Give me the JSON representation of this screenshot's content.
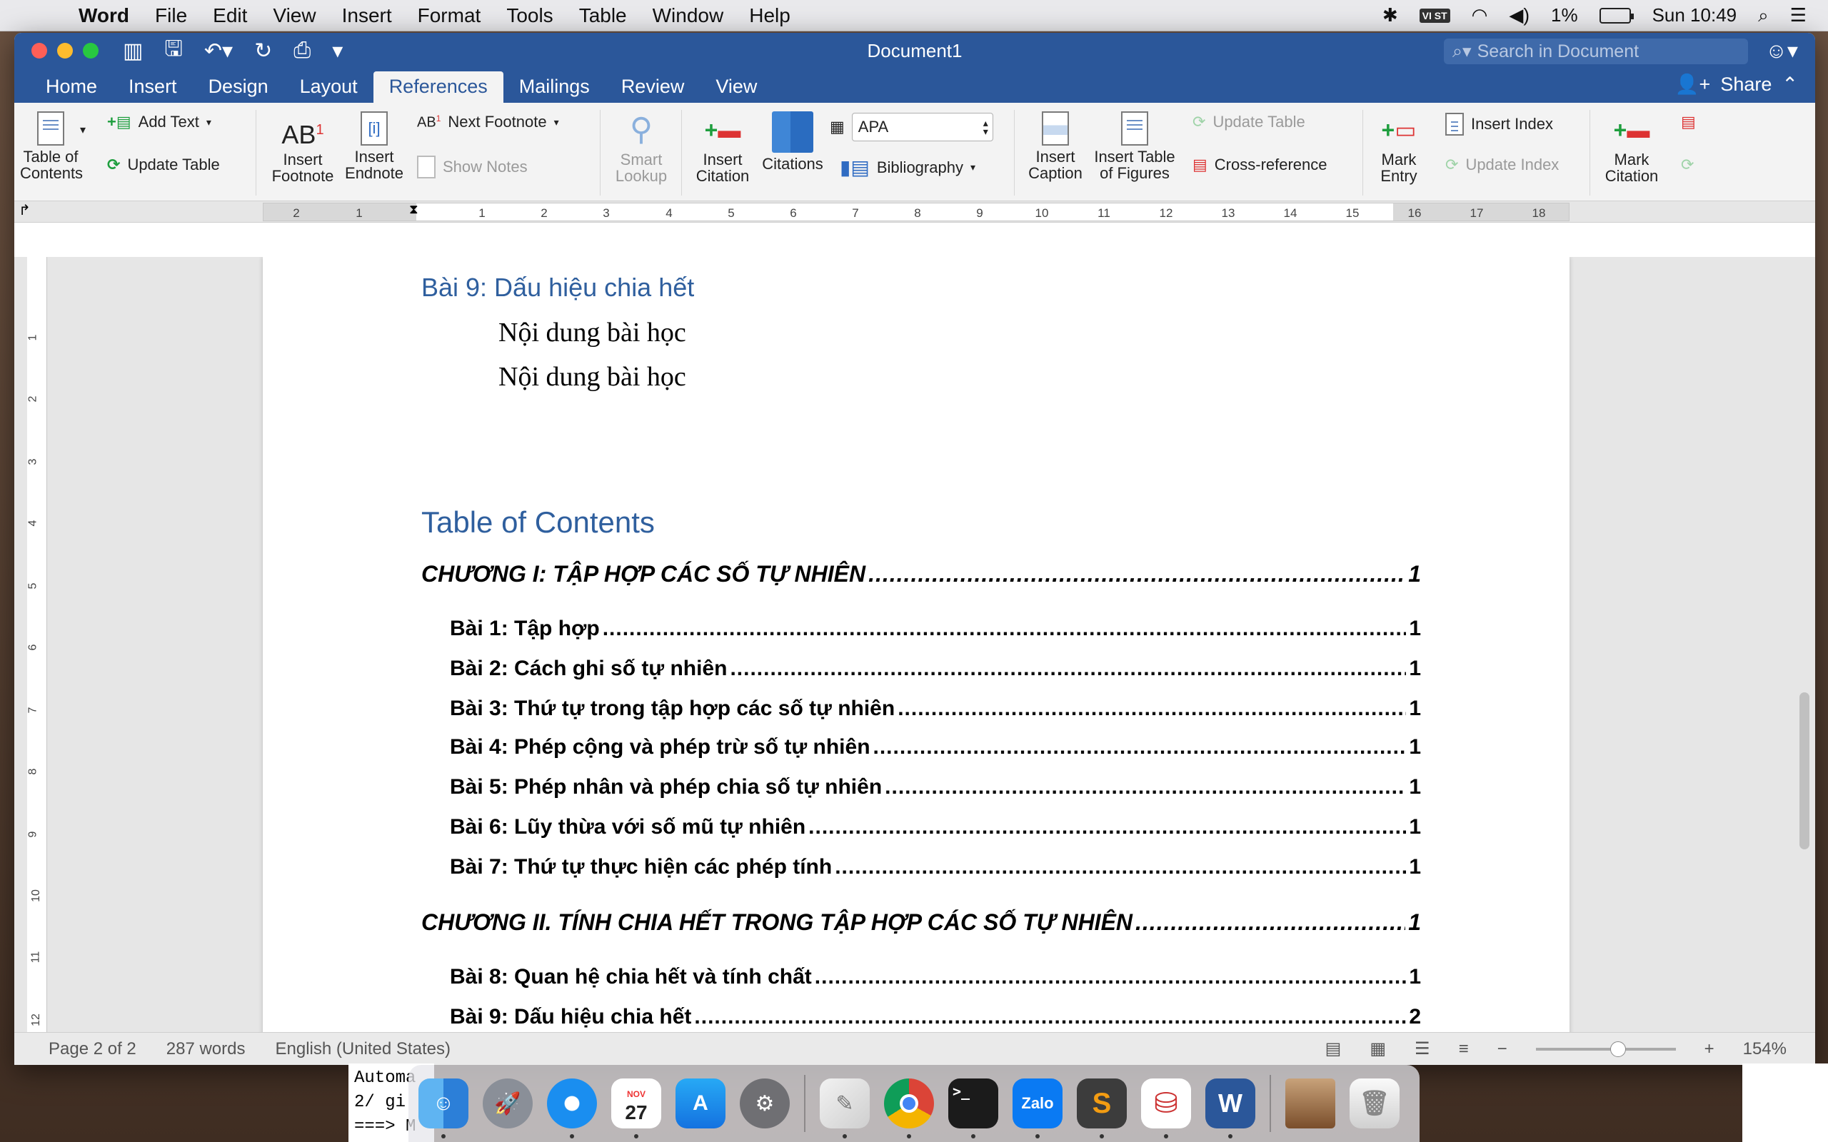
{
  "menubar": {
    "app_name": "Word",
    "items": [
      "File",
      "Edit",
      "View",
      "Insert",
      "Format",
      "Tools",
      "Table",
      "Window",
      "Help"
    ],
    "input_badge": "VI ST",
    "battery": "1%",
    "clock": "Sun 10:49"
  },
  "window": {
    "title": "Document1",
    "search_placeholder": "Search in Document",
    "share_label": "Share",
    "tabs": [
      "Home",
      "Insert",
      "Design",
      "Layout",
      "References",
      "Mailings",
      "Review",
      "View"
    ],
    "active_tab": "References"
  },
  "ribbon": {
    "toc_label_1": "Table of",
    "toc_label_2": "Contents",
    "add_text": "Add Text",
    "update_table": "Update Table",
    "insert_footnote_1": "Insert",
    "insert_footnote_2": "Footnote",
    "insert_endnote_1": "Insert",
    "insert_endnote_2": "Endnote",
    "next_footnote": "Next Footnote",
    "show_notes": "Show Notes",
    "smart_lookup_1": "Smart",
    "smart_lookup_2": "Lookup",
    "insert_citation_1": "Insert",
    "insert_citation_2": "Citation",
    "citations": "Citations",
    "style_value": "APA",
    "bibliography": "Bibliography",
    "insert_caption_1": "Insert",
    "insert_caption_2": "Caption",
    "insert_tof_1": "Insert Table",
    "insert_tof_2": "of Figures",
    "update_table_2": "Update Table",
    "cross_reference": "Cross-reference",
    "mark_entry_1": "Mark",
    "mark_entry_2": "Entry",
    "insert_index": "Insert Index",
    "update_index": "Update Index",
    "mark_citation_1": "Mark",
    "mark_citation_2": "Citation"
  },
  "ruler": {
    "ticks": [
      "2",
      "1",
      "1",
      "2",
      "3",
      "4",
      "5",
      "6",
      "7",
      "8",
      "9",
      "10",
      "11",
      "12",
      "13",
      "14",
      "15",
      "16",
      "17",
      "18"
    ],
    "vticks": [
      "1",
      "2",
      "3",
      "4",
      "5",
      "6",
      "7",
      "8",
      "9",
      "10",
      "11",
      "12"
    ]
  },
  "document": {
    "heading": "Bài 9: Dấu hiệu chia hết",
    "body_lines": [
      "Nội dung bài học",
      "Nội dung bài học"
    ],
    "toc_title": "Table of Contents",
    "toc_entries": [
      {
        "level": 1,
        "text": "CHƯƠNG I: TẬP HỢP CÁC SỐ TỰ NHIÊN",
        "page": "1"
      },
      {
        "level": 2,
        "text": "Bài 1: Tập hợp",
        "page": "1"
      },
      {
        "level": 2,
        "text": "Bài 2: Cách ghi số tự nhiên",
        "page": "1"
      },
      {
        "level": 2,
        "text": "Bài 3: Thứ tự trong tập hợp các số tự nhiên",
        "page": "1"
      },
      {
        "level": 2,
        "text": "Bài 4: Phép cộng và phép trừ số tự nhiên",
        "page": "1"
      },
      {
        "level": 2,
        "text": "Bài 5: Phép nhân và phép chia số tự nhiên",
        "page": "1"
      },
      {
        "level": 2,
        "text": "Bài 6: Lũy thừa với số mũ tự nhiên",
        "page": "1"
      },
      {
        "level": 2,
        "text": "Bài 7: Thứ tự thực hiện các phép tính",
        "page": "1"
      },
      {
        "level": 1,
        "text": "CHƯƠNG II. TÍNH CHIA HẾT TRONG TẬP HỢP CÁC SỐ TỰ NHIÊN",
        "page": "1"
      },
      {
        "level": 2,
        "text": "Bài 8: Quan hệ chia hết và tính chất",
        "page": "1"
      },
      {
        "level": 2,
        "text": "Bài 9: Dấu hiệu chia hết",
        "page": "2"
      }
    ]
  },
  "status": {
    "page": "Page 2 of 2",
    "words": "287 words",
    "language": "English (United States)",
    "zoom": "154%",
    "zoom_fraction": 0.6
  },
  "dock": {
    "calendar_month": "NOV",
    "calendar_day": "27",
    "zalo_label": "Zalo",
    "terminal_prompt": ">_",
    "background_terminal_text": "Automa\n2/ gi\n===> M"
  },
  "colors": {
    "word_blue": "#2b579a",
    "heading_blue": "#2f5f9e"
  }
}
